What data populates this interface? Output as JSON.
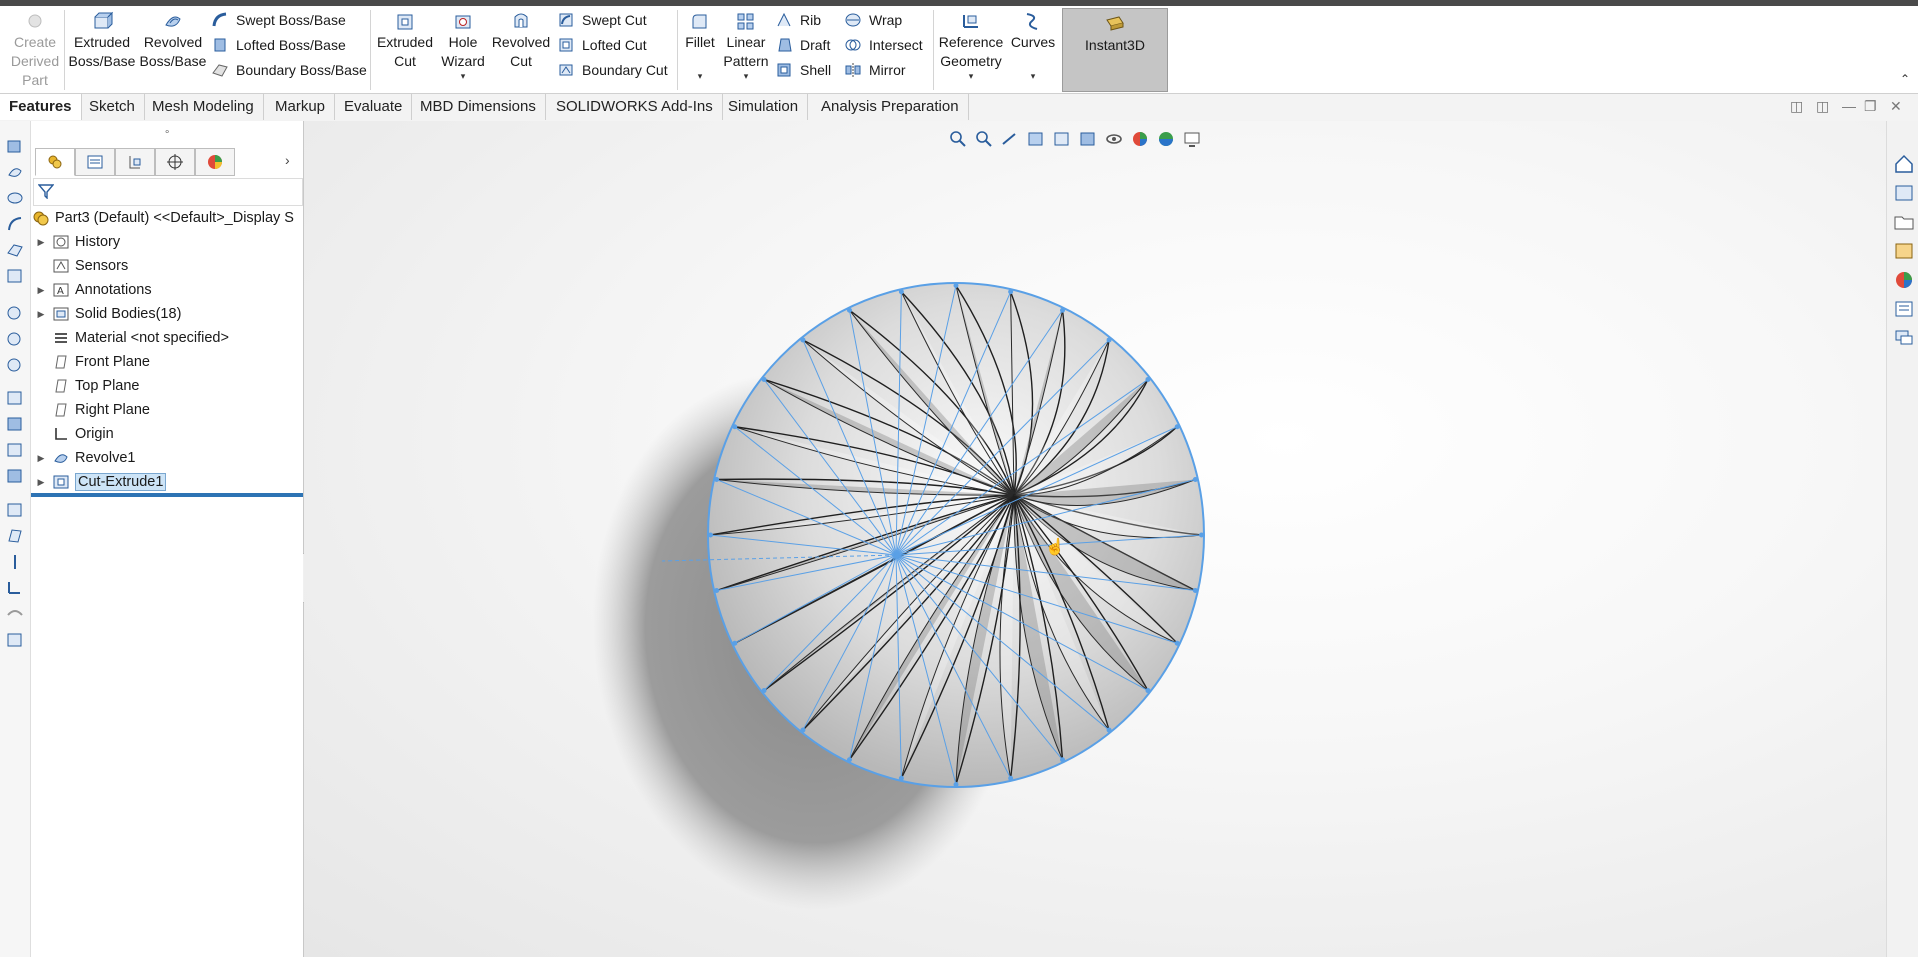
{
  "ribbon": {
    "create_derived_part": "Create\nDerived\nPart",
    "extruded_boss": "Extruded\nBoss/Base",
    "revolved_boss": "Revolved\nBoss/Base",
    "swept_boss": "Swept Boss/Base",
    "lofted_boss": "Lofted Boss/Base",
    "boundary_boss": "Boundary Boss/Base",
    "extruded_cut": "Extruded\nCut",
    "hole_wizard": "Hole\nWizard",
    "revolved_cut": "Revolved\nCut",
    "swept_cut": "Swept Cut",
    "lofted_cut": "Lofted Cut",
    "boundary_cut": "Boundary Cut",
    "fillet": "Fillet",
    "linear_pattern": "Linear\nPattern",
    "rib": "Rib",
    "draft": "Draft",
    "shell": "Shell",
    "wrap": "Wrap",
    "intersect": "Intersect",
    "mirror": "Mirror",
    "reference_geometry": "Reference\nGeometry",
    "curves": "Curves",
    "instant3d": "Instant3D"
  },
  "tabs": [
    {
      "label": "Features",
      "active": true
    },
    {
      "label": "Sketch"
    },
    {
      "label": "Mesh Modeling"
    },
    {
      "label": "Markup"
    },
    {
      "label": "Evaluate"
    },
    {
      "label": "MBD Dimensions"
    },
    {
      "label": "SOLIDWORKS Add-Ins"
    },
    {
      "label": "Simulation"
    },
    {
      "label": "Analysis Preparation"
    }
  ],
  "tree": {
    "root": "Part3  (Default) <<Default>_Display S",
    "items": [
      {
        "label": "History",
        "icon": "history-icon"
      },
      {
        "label": "Sensors",
        "icon": "sensors-icon"
      },
      {
        "label": "Annotations",
        "icon": "annotations-icon"
      },
      {
        "label": "Solid Bodies(18)",
        "icon": "solid-bodies-icon"
      },
      {
        "label": "Material <not specified>",
        "icon": "material-icon"
      },
      {
        "label": "Front Plane",
        "icon": "plane-icon"
      },
      {
        "label": "Top Plane",
        "icon": "plane-icon"
      },
      {
        "label": "Right Plane",
        "icon": "plane-icon"
      },
      {
        "label": "Origin",
        "icon": "origin-icon"
      },
      {
        "label": "Revolve1",
        "icon": "revolve-icon"
      },
      {
        "label": "Cut-Extrude1",
        "icon": "cut-extrude-icon"
      }
    ]
  },
  "colors": {
    "accent": "#2d73b4",
    "selection_blue": "#5aa0e6",
    "instant3d_bg": "#c5c5c5"
  }
}
